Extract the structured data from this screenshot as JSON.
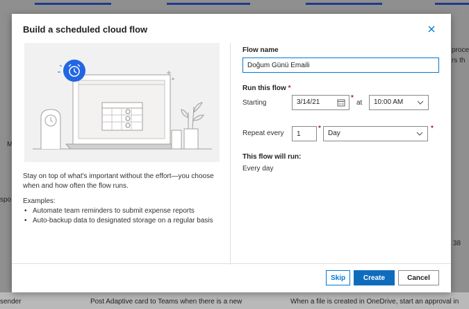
{
  "background": {
    "fragments": [
      {
        "text": "M"
      },
      {
        "text": "spo"
      },
      {
        "text": "proce"
      },
      {
        "text": "rs th"
      },
      {
        "text": "38"
      }
    ],
    "bottom": {
      "item1": "sender",
      "item2": "Post Adaptive card to Teams when there is a new",
      "item3": "When a file is created in OneDrive, start an approval in"
    }
  },
  "dialog": {
    "title": "Build a scheduled cloud flow",
    "close_icon": "close-icon",
    "description": "Stay on top of what's important without the effort—you choose when and how often the flow runs.",
    "examples_label": "Examples:",
    "examples": [
      "Automate team reminders to submit expense reports",
      "Auto-backup data to designated storage on a regular basis"
    ],
    "flow_name_label": "Flow name",
    "flow_name_value": "Doğum Günü Emaili",
    "run_label": "Run this flow",
    "required_mark": "*",
    "starting_label": "Starting",
    "start_date": "3/14/21",
    "at_label": "at",
    "start_time": "10:00 AM",
    "repeat_label": "Repeat every",
    "repeat_interval": "1",
    "repeat_unit": "Day",
    "will_run_label": "This flow will run:",
    "will_run_value": "Every day",
    "buttons": {
      "skip": "Skip",
      "create": "Create",
      "cancel": "Cancel"
    },
    "colors": {
      "accent": "#0078d4",
      "primary_button": "#0f6cbd",
      "required": "#a4262c"
    }
  }
}
